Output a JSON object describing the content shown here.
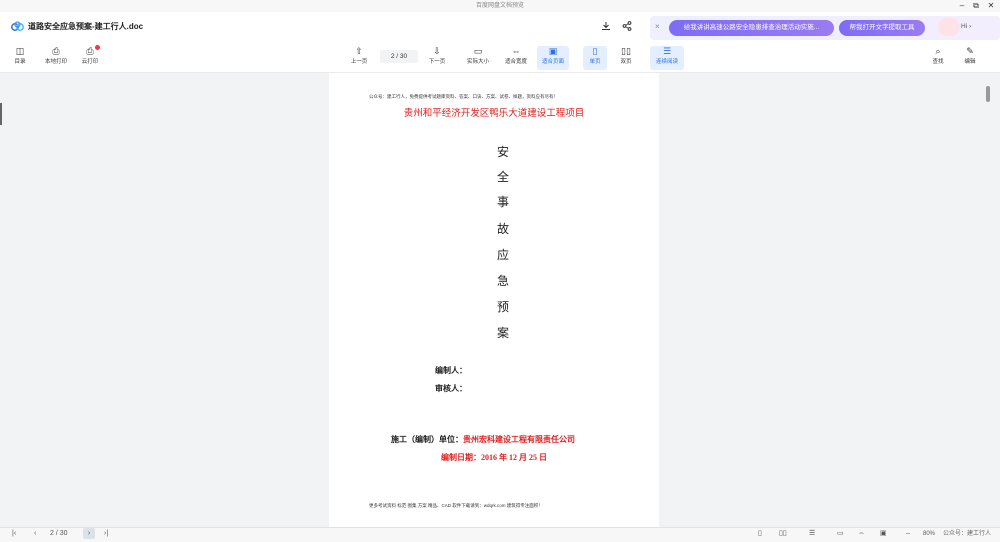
{
  "window": {
    "title": "百度网盘文档预览",
    "min": "–",
    "restore": "⧉",
    "close": "✕"
  },
  "doc": {
    "filename": "道路安全应急预案-建工行人.doc"
  },
  "ai": {
    "close": "×",
    "suggestion1": "给我讲讲高速公路安全隐患排查治理活动实施...",
    "suggestion2": "帮我打开文字提取工具",
    "hi": "Hi ›"
  },
  "toolbar": {
    "catalog": "目录",
    "local_print": "本地打印",
    "cloud_print": "云打印",
    "prev": "上一页",
    "page_indicator": "2 / 30",
    "next": "下一页",
    "actual_size": "实际大小",
    "fit_width": "适合宽度",
    "fit_page": "适合页面",
    "single": "单页",
    "double": "双页",
    "continuous": "连续阅读",
    "find": "查找",
    "edit": "编辑"
  },
  "page": {
    "header_note": "公众号：建工行人，免费提供考试题库资料、答案、口诀、方案、试卷、样题，资料应有尽有！",
    "project_title": "贵州和平经济开发区鸭乐大道建设工程项目",
    "vertical_title": [
      "安",
      "全",
      "事",
      "故",
      "应",
      "急",
      "预",
      "案"
    ],
    "compiler_label": "编制人：",
    "reviewer_label": "审核人：",
    "unit_label": "施工（编制）单位：",
    "unit_value": "贵州宏科建设工程有限责任公司",
    "date_line": "编制日期：2016 年 12 月 25 日",
    "footer_note": "更多考试资料 标范 图集 方案 精品、CAD 软件下载请到：wdqrk.com 建筑得专注面积！"
  },
  "bottom": {
    "page_indicator": "2 / 30",
    "zoom": "80%",
    "watermark": "公众号：建工行人"
  },
  "colors": {
    "red": "#e02020",
    "accent": "#7d6cf6",
    "active_bg": "#e3efff"
  }
}
